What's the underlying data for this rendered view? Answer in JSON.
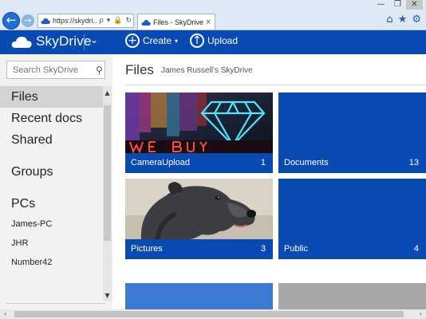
{
  "browser": {
    "url": "https://skydri...",
    "tab_title": "Files - SkyDrive",
    "back_icon": "←",
    "forward_icon": "→",
    "window_controls": [
      "—",
      "❐",
      "✕"
    ],
    "address_controls": [
      "ρ",
      "▾",
      "🔒",
      "↻"
    ],
    "tab_close": "×",
    "tool_icons": [
      "⌂",
      "★",
      "⚙"
    ]
  },
  "app": {
    "brand": "SkyDrive",
    "brand_chevron": "⌄",
    "commands": [
      {
        "label": "Create",
        "icon": "+",
        "caret": "▾"
      },
      {
        "label": "Upload",
        "icon": "↑",
        "caret": ""
      }
    ],
    "accent": "#094ab2"
  },
  "sidebar": {
    "search_placeholder": "Search SkyDrive",
    "search_icon": "⚲",
    "items": [
      {
        "label": "Files",
        "selected": true
      },
      {
        "label": "Recent docs"
      },
      {
        "label": "Shared"
      },
      {
        "label": "Groups"
      },
      {
        "label": "PCs"
      },
      {
        "label": "James-PC"
      },
      {
        "label": "JHR"
      },
      {
        "label": "Number42"
      }
    ]
  },
  "main": {
    "title": "Files",
    "subtitle": "James Russell's SkyDrive",
    "tiles": [
      {
        "label": "CameraUpload",
        "count": "1",
        "thumb": "diamond-neon-sign"
      },
      {
        "label": "Documents",
        "count": "13"
      },
      {
        "label": "Pictures",
        "count": "3",
        "thumb": "dog-photo"
      },
      {
        "label": "Public",
        "count": "4"
      }
    ],
    "tile_color": "#094ab2",
    "partial_tile_colors": [
      "#3c7ad6",
      "#a8a8a8"
    ]
  },
  "scroll": {
    "up": "▲",
    "down": "▼",
    "left": "‹",
    "right": "›"
  }
}
